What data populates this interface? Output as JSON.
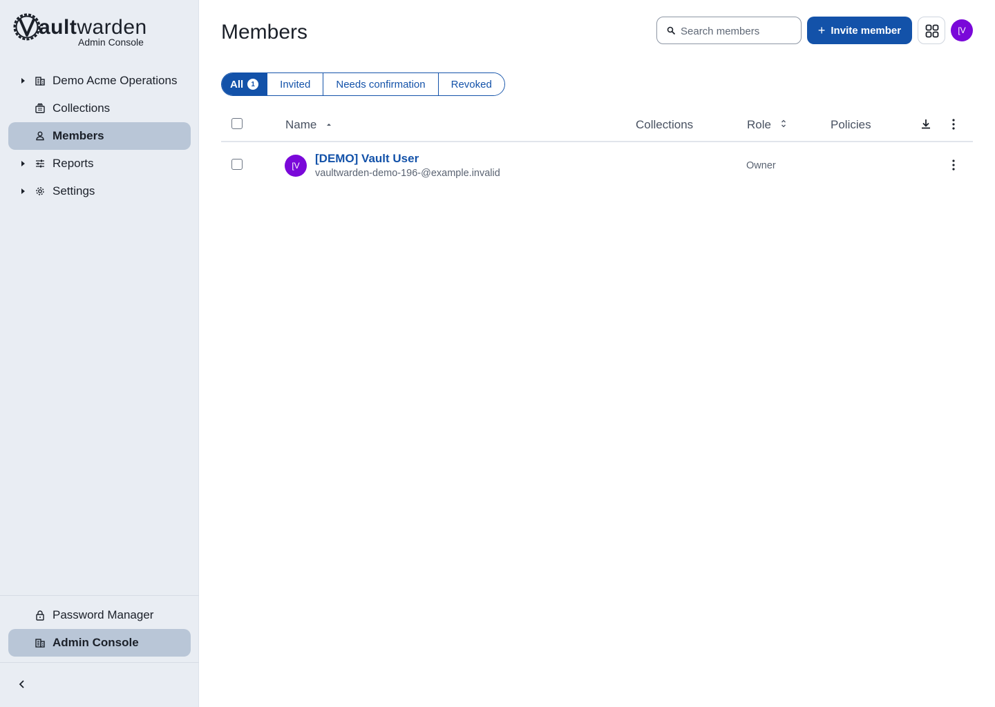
{
  "brand": {
    "wordmark_bold": "ault",
    "wordmark_rest": "warden",
    "subtitle": "Admin Console"
  },
  "sidebar": {
    "items": [
      {
        "label": "Demo Acme Operations",
        "icon": "building-icon",
        "expandable": true,
        "active": false
      },
      {
        "label": "Collections",
        "icon": "collection-icon",
        "expandable": false,
        "active": false
      },
      {
        "label": "Members",
        "icon": "user-icon",
        "expandable": false,
        "active": true
      },
      {
        "label": "Reports",
        "icon": "sliders-icon",
        "expandable": true,
        "active": false
      },
      {
        "label": "Settings",
        "icon": "gear-icon",
        "expandable": true,
        "active": false
      }
    ],
    "bottom_items": [
      {
        "label": "Password Manager",
        "icon": "lock-icon",
        "active": false
      },
      {
        "label": "Admin Console",
        "icon": "building-icon",
        "active": true
      }
    ]
  },
  "header": {
    "title": "Members",
    "search_placeholder": "Search members",
    "invite_label": "Invite member",
    "avatar_initials": "[V"
  },
  "filters": {
    "tabs": [
      {
        "label": "All",
        "count": "1",
        "active": true
      },
      {
        "label": "Invited",
        "active": false
      },
      {
        "label": "Needs confirmation",
        "active": false
      },
      {
        "label": "Revoked",
        "active": false
      }
    ]
  },
  "table": {
    "columns": {
      "name": "Name",
      "collections": "Collections",
      "role": "Role",
      "policies": "Policies"
    },
    "rows": [
      {
        "initials": "[V",
        "name": "[DEMO] Vault User",
        "email": "vaultwarden-demo-196-@example.invalid",
        "role": "Owner"
      }
    ]
  },
  "colors": {
    "primary": "#1352a9",
    "avatar": "#7a08d9",
    "sidebar_bg": "#e9edf3",
    "sidebar_active": "#b9c6d7"
  }
}
